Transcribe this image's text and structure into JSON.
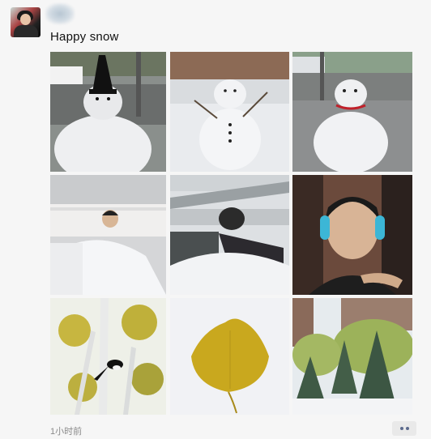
{
  "post": {
    "caption": "Happy snow",
    "timestamp": "1小时前"
  },
  "photos": [
    {
      "subject": "snowman-with-black-hat"
    },
    {
      "subject": "snowman-with-stick-arms"
    },
    {
      "subject": "snowman-with-red-scarf"
    },
    {
      "subject": "person-behind-snow-pile"
    },
    {
      "subject": "covered-car-under-snow"
    },
    {
      "subject": "man-with-headphones"
    },
    {
      "subject": "magpie-in-yellow-tree"
    },
    {
      "subject": "yellow-leaf-on-snow"
    },
    {
      "subject": "snowy-pine-trees"
    }
  ],
  "icons": {
    "more": "more-dots-icon"
  },
  "colors": {
    "background": "#f6f6f6",
    "caption": "#111111",
    "timestamp": "#8a8a8a",
    "more_dots": "#5b6a8c"
  }
}
